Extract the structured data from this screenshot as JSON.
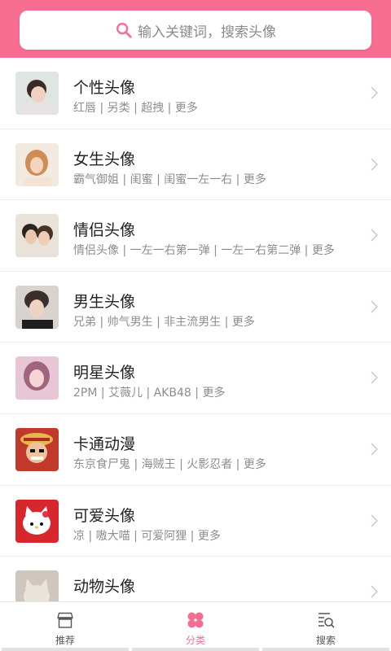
{
  "search": {
    "placeholder": "输入关键词，搜索头像"
  },
  "colors": {
    "accent": "#f76d92"
  },
  "categories": [
    {
      "title": "个性头像",
      "tags": "红唇 | 另类 | 超拽 | 更多"
    },
    {
      "title": "女生头像",
      "tags": "霸气御姐 | 闺蜜 | 闺蜜一左一右 | 更多"
    },
    {
      "title": "情侣头像",
      "tags": "情侣头像 | 一左一右第一弹 | 一左一右第二弹 | 更多"
    },
    {
      "title": "男生头像",
      "tags": "兄弟 | 帅气男生 | 非主流男生 | 更多"
    },
    {
      "title": "明星头像",
      "tags": "2PM | 艾薇儿 | AKB48 | 更多"
    },
    {
      "title": "卡通动漫",
      "tags": "东京食尸鬼 | 海贼王 | 火影忍者 | 更多"
    },
    {
      "title": "可爱头像",
      "tags": "凉 | 嗷大喵 | 可爱阿狸 | 更多"
    },
    {
      "title": "动物头像",
      "tags": ""
    }
  ],
  "tabbar": {
    "items": [
      {
        "label": "推荐",
        "icon": "store-icon"
      },
      {
        "label": "分类",
        "icon": "clover-icon"
      },
      {
        "label": "搜索",
        "icon": "list-search-icon"
      }
    ],
    "active": 1
  }
}
